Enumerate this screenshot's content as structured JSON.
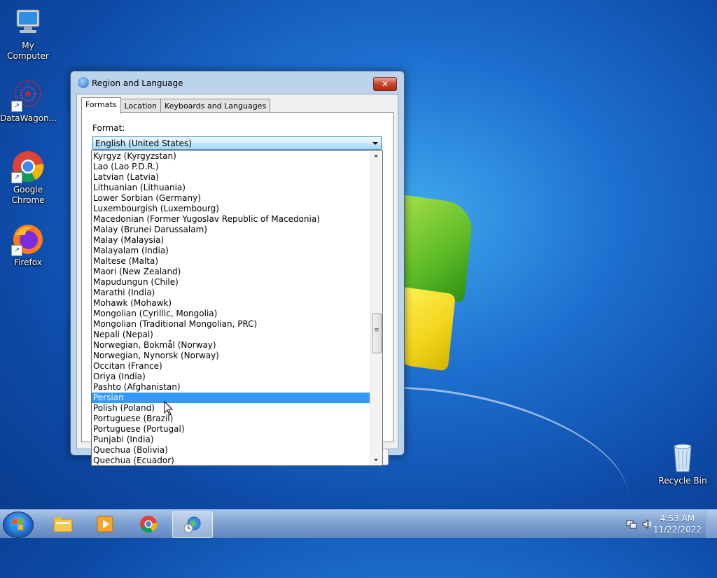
{
  "desktop": {
    "icons": [
      {
        "label": "My Computer",
        "icon": "computer-icon"
      },
      {
        "label": "DataWagon...",
        "icon": "datawagon-icon"
      },
      {
        "label": "Google Chrome",
        "icon": "chrome-icon"
      },
      {
        "label": "Firefox",
        "icon": "firefox-icon"
      },
      {
        "label": "Recycle Bin",
        "icon": "recycle-bin-icon"
      }
    ]
  },
  "dialog": {
    "title": "Region and Language",
    "close_glyph": "✕",
    "tabs": [
      "Formats",
      "Location",
      "Keyboards and Languages"
    ],
    "active_tab": "Formats",
    "format_label": "Format:",
    "format_value": "English (United States)"
  },
  "dropdown": {
    "items": [
      "Kyrgyz (Kyrgyzstan)",
      "Lao (Lao P.D.R.)",
      "Latvian (Latvia)",
      "Lithuanian (Lithuania)",
      "Lower Sorbian (Germany)",
      "Luxembourgish (Luxembourg)",
      "Macedonian (Former Yugoslav Republic of Macedonia)",
      "Malay (Brunei Darussalam)",
      "Malay (Malaysia)",
      "Malayalam (India)",
      "Maltese (Malta)",
      "Maori (New Zealand)",
      "Mapudungun (Chile)",
      "Marathi (India)",
      "Mohawk (Mohawk)",
      "Mongolian (Cyrillic, Mongolia)",
      "Mongolian (Traditional Mongolian, PRC)",
      "Nepali (Nepal)",
      "Norwegian, Bokmål (Norway)",
      "Norwegian, Nynorsk (Norway)",
      "Occitan (France)",
      "Oriya (India)",
      "Pashto (Afghanistan)",
      "Persian",
      "Polish (Poland)",
      "Portuguese (Brazil)",
      "Portuguese (Portugal)",
      "Punjabi (India)",
      "Quechua (Bolivia)",
      "Quechua (Ecuador)"
    ],
    "selected_index": 23,
    "selection_color": "#3399ff"
  },
  "taskbar": {
    "apps": [
      "windows-explorer-icon",
      "media-player-icon",
      "chrome-icon",
      "region-language-icon"
    ],
    "active_app": "region-language-icon",
    "clock_time": "4:53 AM",
    "clock_date": "11/22/2022"
  },
  "colors": {
    "desktop_bg": "#1d6fcf",
    "dialog_frame": "#bcd3ec",
    "close_button": "#c7452e"
  }
}
